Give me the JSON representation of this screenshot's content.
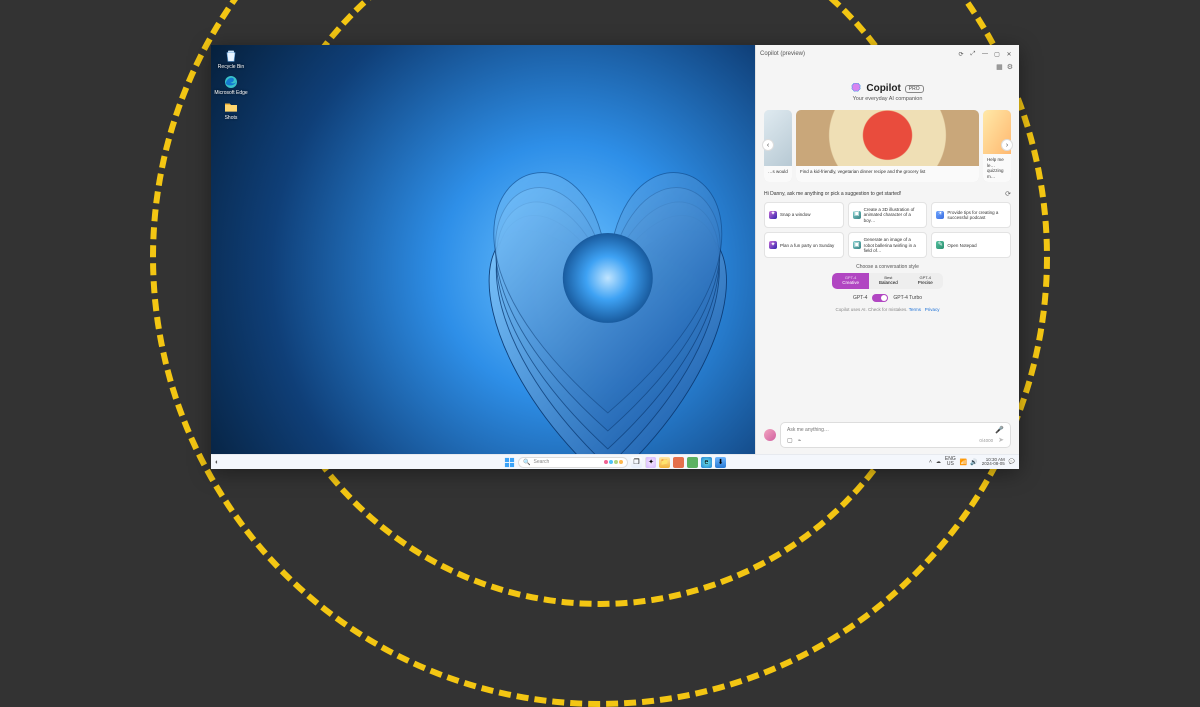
{
  "desktop": {
    "icons": [
      {
        "name": "recycle-bin",
        "label": "Recycle Bin"
      },
      {
        "name": "edge-shortcut",
        "label": "Microsoft Edge"
      },
      {
        "name": "folder-shortcut",
        "label": "Shots"
      }
    ]
  },
  "copilot": {
    "window_title": "Copilot (preview)",
    "brand": "Copilot",
    "badge": "PRO",
    "subtitle": "Your everyday AI companion",
    "strip_cards": [
      {
        "caption": "…s would"
      },
      {
        "caption": "Find a kid-friendly, vegetarian dinner recipe and the grocery list"
      },
      {
        "caption": "Help me le… quizzing m…"
      }
    ],
    "greeting": "Hi Danny, ask me anything or pick a suggestion to get started!",
    "suggestions": [
      {
        "icon": "sparkle",
        "text": "Snap a window"
      },
      {
        "icon": "img",
        "text": "Create a 3D illustration of animated character of a boy…"
      },
      {
        "icon": "idea",
        "text": "Provide tips for creating a successful podcast"
      },
      {
        "icon": "sparkle",
        "text": "Plan a fun party on Sunday"
      },
      {
        "icon": "img",
        "text": "Generate an image of a robot ballerina twirling in a field of…"
      },
      {
        "icon": "note",
        "text": "Open Notepad"
      }
    ],
    "choose_label": "Choose a conversation style",
    "styles": [
      {
        "top": "GPT-4",
        "main": "Creative",
        "active": true
      },
      {
        "top": "Best",
        "main": "Balanced",
        "active": false
      },
      {
        "top": "GPT-4",
        "main": "Precise",
        "active": false
      }
    ],
    "model_left": "GPT-4",
    "model_right": "GPT-4 Turbo",
    "model_toggle_on": true,
    "disclaimer_text": "Copilot uses AI. Check for mistakes.",
    "terms": "Terms",
    "privacy": "Privacy",
    "input_placeholder": "Ask me anything…",
    "char_counter": "0/4000"
  },
  "taskbar": {
    "search_placeholder": "Search",
    "lang_top": "ENG",
    "lang_bottom": "US",
    "time": "10:30 AM",
    "date": "2024-08-05"
  }
}
